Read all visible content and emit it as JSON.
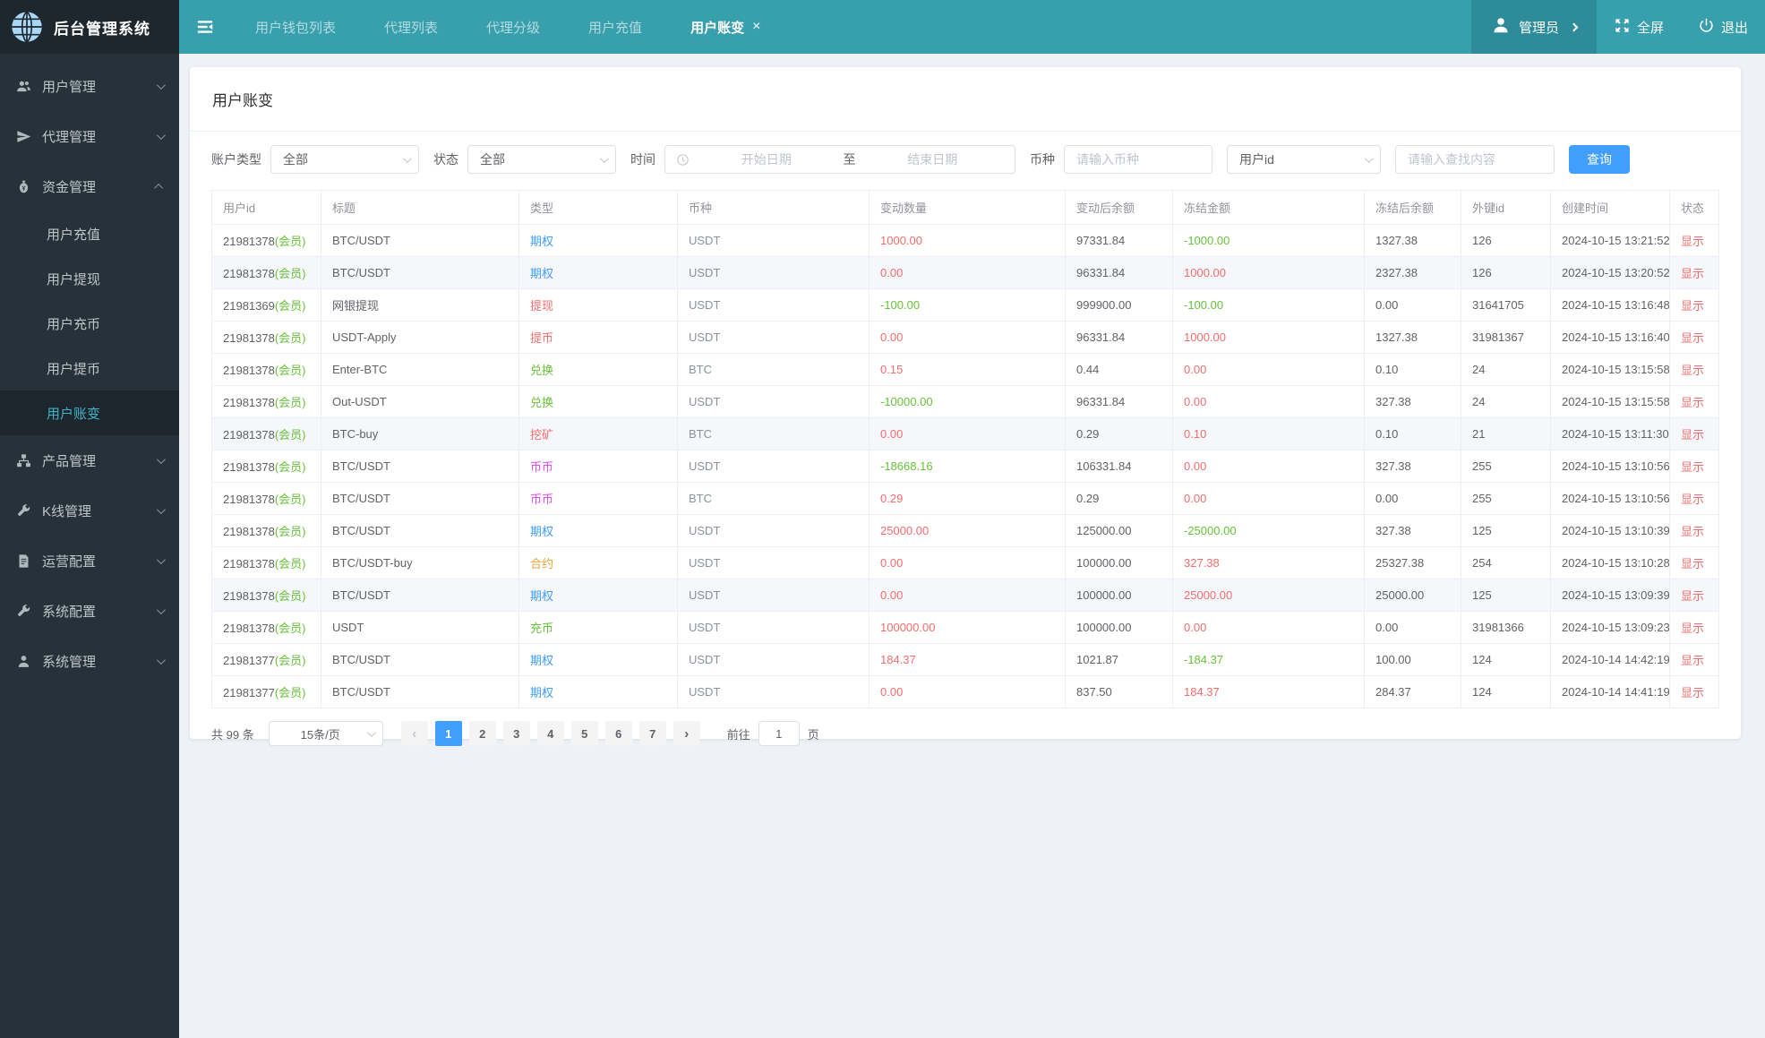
{
  "app": {
    "title": "后台管理系统"
  },
  "header": {
    "tabs": [
      {
        "label": "用户钱包列表",
        "active": false,
        "closable": false
      },
      {
        "label": "代理列表",
        "active": false,
        "closable": false
      },
      {
        "label": "代理分级",
        "active": false,
        "closable": false
      },
      {
        "label": "用户充值",
        "active": false,
        "closable": false
      },
      {
        "label": "用户账变",
        "active": true,
        "closable": true
      }
    ],
    "user_label": "管理员",
    "fullscreen_label": "全屏",
    "logout_label": "退出"
  },
  "sidebar": {
    "items": [
      {
        "label": "用户管理",
        "icon": "users-icon",
        "expanded": false
      },
      {
        "label": "代理管理",
        "icon": "agent-icon",
        "expanded": false
      },
      {
        "label": "资金管理",
        "icon": "funds-icon",
        "expanded": true,
        "children": [
          {
            "label": "用户充值",
            "active": false
          },
          {
            "label": "用户提现",
            "active": false
          },
          {
            "label": "用户充币",
            "active": false
          },
          {
            "label": "用户提币",
            "active": false
          },
          {
            "label": "用户账变",
            "active": true
          }
        ]
      },
      {
        "label": "产品管理",
        "icon": "product-icon",
        "expanded": false
      },
      {
        "label": "K线管理",
        "icon": "kline-icon",
        "expanded": false
      },
      {
        "label": "运营配置",
        "icon": "operation-icon",
        "expanded": false
      },
      {
        "label": "系统配置",
        "icon": "system-config-icon",
        "expanded": false
      },
      {
        "label": "系统管理",
        "icon": "system-manage-icon",
        "expanded": false
      }
    ]
  },
  "page": {
    "title": "用户账变",
    "filters": {
      "account_type_label": "账户类型",
      "account_type_value": "全部",
      "status_label": "状态",
      "status_value": "全部",
      "time_label": "时间",
      "date_start_placeholder": "开始日期",
      "date_separator": "至",
      "date_end_placeholder": "结束日期",
      "coin_label": "币种",
      "coin_placeholder": "请输入币种",
      "search_field_value": "用户id",
      "search_placeholder": "请输入查找内容",
      "search_button": "查询"
    },
    "table": {
      "headers": [
        "用户id",
        "标题",
        "类型",
        "币种",
        "变动数量",
        "变动后余额",
        "冻结金额",
        "冻结后余额",
        "外键id",
        "创建时间",
        "状态"
      ],
      "rows": [
        {
          "uid": "21981378",
          "member": "(会员)",
          "title": "BTC/USDT",
          "type": "期权",
          "type_color": "blue",
          "coin": "USDT",
          "change": "1000.00",
          "change_color": "red",
          "after": "97331.84",
          "frozen": "-1000.00",
          "frozen_color": "green",
          "frozen_after": "1327.38",
          "fk": "126",
          "time": "2024-10-15 13:21:52",
          "status": "显示",
          "striped": false
        },
        {
          "uid": "21981378",
          "member": "(会员)",
          "title": "BTC/USDT",
          "type": "期权",
          "type_color": "blue",
          "coin": "USDT",
          "change": "0.00",
          "change_color": "red",
          "after": "96331.84",
          "frozen": "1000.00",
          "frozen_color": "red",
          "frozen_after": "2327.38",
          "fk": "126",
          "time": "2024-10-15 13:20:52",
          "status": "显示",
          "striped": true
        },
        {
          "uid": "21981369",
          "member": "(会员)",
          "title": "网银提现",
          "type": "提现",
          "type_color": "red",
          "coin": "USDT",
          "change": "-100.00",
          "change_color": "green",
          "after": "999900.00",
          "frozen": "-100.00",
          "frozen_color": "green",
          "frozen_after": "0.00",
          "fk": "31641705",
          "time": "2024-10-15 13:16:48",
          "status": "显示",
          "striped": false
        },
        {
          "uid": "21981378",
          "member": "(会员)",
          "title": "USDT-Apply",
          "type": "提币",
          "type_color": "red",
          "coin": "USDT",
          "change": "0.00",
          "change_color": "red",
          "after": "96331.84",
          "frozen": "1000.00",
          "frozen_color": "red",
          "frozen_after": "1327.38",
          "fk": "31981367",
          "time": "2024-10-15 13:16:40",
          "status": "显示",
          "striped": false
        },
        {
          "uid": "21981378",
          "member": "(会员)",
          "title": "Enter-BTC",
          "type": "兑换",
          "type_color": "green",
          "coin": "BTC",
          "change": "0.15",
          "change_color": "red",
          "after": "0.44",
          "frozen": "0.00",
          "frozen_color": "red",
          "frozen_after": "0.10",
          "fk": "24",
          "time": "2024-10-15 13:15:58",
          "status": "显示",
          "striped": false
        },
        {
          "uid": "21981378",
          "member": "(会员)",
          "title": "Out-USDT",
          "type": "兑换",
          "type_color": "green",
          "coin": "USDT",
          "change": "-10000.00",
          "change_color": "green",
          "after": "96331.84",
          "frozen": "0.00",
          "frozen_color": "red",
          "frozen_after": "327.38",
          "fk": "24",
          "time": "2024-10-15 13:15:58",
          "status": "显示",
          "striped": false
        },
        {
          "uid": "21981378",
          "member": "(会员)",
          "title": "BTC-buy",
          "type": "挖矿",
          "type_color": "red",
          "coin": "BTC",
          "change": "0.00",
          "change_color": "red",
          "after": "0.29",
          "frozen": "0.10",
          "frozen_color": "red",
          "frozen_after": "0.10",
          "fk": "21",
          "time": "2024-10-15 13:11:30",
          "status": "显示",
          "striped": true
        },
        {
          "uid": "21981378",
          "member": "(会员)",
          "title": "BTC/USDT",
          "type": "币币",
          "type_color": "magenta",
          "coin": "USDT",
          "change": "-18668.16",
          "change_color": "green",
          "after": "106331.84",
          "frozen": "0.00",
          "frozen_color": "red",
          "frozen_after": "327.38",
          "fk": "255",
          "time": "2024-10-15 13:10:56",
          "status": "显示",
          "striped": false
        },
        {
          "uid": "21981378",
          "member": "(会员)",
          "title": "BTC/USDT",
          "type": "币币",
          "type_color": "magenta",
          "coin": "BTC",
          "change": "0.29",
          "change_color": "red",
          "after": "0.29",
          "frozen": "0.00",
          "frozen_color": "red",
          "frozen_after": "0.00",
          "fk": "255",
          "time": "2024-10-15 13:10:56",
          "status": "显示",
          "striped": false
        },
        {
          "uid": "21981378",
          "member": "(会员)",
          "title": "BTC/USDT",
          "type": "期权",
          "type_color": "blue",
          "coin": "USDT",
          "change": "25000.00",
          "change_color": "red",
          "after": "125000.00",
          "frozen": "-25000.00",
          "frozen_color": "green",
          "frozen_after": "327.38",
          "fk": "125",
          "time": "2024-10-15 13:10:39",
          "status": "显示",
          "striped": false
        },
        {
          "uid": "21981378",
          "member": "(会员)",
          "title": "BTC/USDT-buy",
          "type": "合约",
          "type_color": "orange",
          "coin": "USDT",
          "change": "0.00",
          "change_color": "red",
          "after": "100000.00",
          "frozen": "327.38",
          "frozen_color": "red",
          "frozen_after": "25327.38",
          "fk": "254",
          "time": "2024-10-15 13:10:28",
          "status": "显示",
          "striped": false
        },
        {
          "uid": "21981378",
          "member": "(会员)",
          "title": "BTC/USDT",
          "type": "期权",
          "type_color": "blue",
          "coin": "USDT",
          "change": "0.00",
          "change_color": "red",
          "after": "100000.00",
          "frozen": "25000.00",
          "frozen_color": "red",
          "frozen_after": "25000.00",
          "fk": "125",
          "time": "2024-10-15 13:09:39",
          "status": "显示",
          "striped": true
        },
        {
          "uid": "21981378",
          "member": "(会员)",
          "title": "USDT",
          "type": "充币",
          "type_color": "green",
          "coin": "USDT",
          "change": "100000.00",
          "change_color": "red",
          "after": "100000.00",
          "frozen": "0.00",
          "frozen_color": "red",
          "frozen_after": "0.00",
          "fk": "31981366",
          "time": "2024-10-15 13:09:23",
          "status": "显示",
          "striped": false
        },
        {
          "uid": "21981377",
          "member": "(会员)",
          "title": "BTC/USDT",
          "type": "期权",
          "type_color": "blue",
          "coin": "USDT",
          "change": "184.37",
          "change_color": "red",
          "after": "1021.87",
          "frozen": "-184.37",
          "frozen_color": "green",
          "frozen_after": "100.00",
          "fk": "124",
          "time": "2024-10-14 14:42:19",
          "status": "显示",
          "striped": false
        },
        {
          "uid": "21981377",
          "member": "(会员)",
          "title": "BTC/USDT",
          "type": "期权",
          "type_color": "blue",
          "coin": "USDT",
          "change": "0.00",
          "change_color": "red",
          "after": "837.50",
          "frozen": "184.37",
          "frozen_color": "red",
          "frozen_after": "284.37",
          "fk": "124",
          "time": "2024-10-14 14:41:19",
          "status": "显示",
          "striped": false
        }
      ]
    },
    "pagination": {
      "total_label": "共 99 条",
      "page_size": "15条/页",
      "prev_label": "‹",
      "next_label": "›",
      "pages": [
        "1",
        "2",
        "3",
        "4",
        "5",
        "6",
        "7"
      ],
      "active_page": "1",
      "goto_label": "前往",
      "goto_value": "1",
      "goto_suffix": "页"
    }
  },
  "colors": {
    "header_teal": "#389fad",
    "admin_block_teal": "#2e8b99",
    "sidebar_dark": "#273139",
    "sidebar_active_text": "#41b2c9",
    "accent_blue": "#409eff",
    "positive_red": "#f56c6c",
    "negative_green": "#67c23a",
    "tag_magenta": "#df4df2",
    "tag_orange": "#e6a23c"
  }
}
